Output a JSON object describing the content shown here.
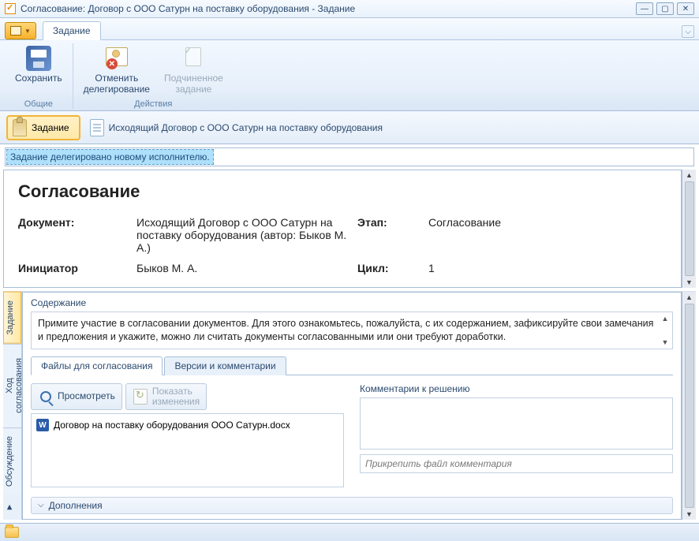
{
  "window": {
    "title": "Согласование: Договор с ООО Сатурн на поставку оборудования - Задание"
  },
  "ribbon": {
    "tab_label": "Задание",
    "groups": {
      "general_label": "Общие",
      "actions_label": "Действия"
    },
    "buttons": {
      "save": "Сохранить",
      "cancel_delegation_l1": "Отменить",
      "cancel_delegation_l2": "делегирование",
      "sub_task_l1": "Подчиненное",
      "sub_task_l2": "задание"
    }
  },
  "subheader": {
    "task_btn": "Задание",
    "doc_link": "Исходящий Договор с ООО Сатурн на поставку оборудования"
  },
  "info_bar": "Задание делегировано новому исполнителю.",
  "form": {
    "heading": "Согласование",
    "labels": {
      "document": "Документ:",
      "stage": "Этап:",
      "initiator_l1": "Инициатор",
      "cycle": "Цикл:"
    },
    "values": {
      "document": "Исходящий Договор с ООО Сатурн на поставку оборудования (автор: Быков М. А.)",
      "stage": "Согласование",
      "initiator": "Быков М. А.",
      "cycle": "1"
    }
  },
  "lower": {
    "side_tabs": {
      "task": "Задание",
      "flow": "Ход согласования",
      "discussion": "Обсуждение"
    },
    "content_label": "Содержание",
    "content_text": "Примите участие в согласовании документов. Для этого ознакомьтесь, пожалуйста, с их содержанием, зафиксируйте свои замечания и предложения и укажите, можно ли считать документы согласованными или они требуют доработки.",
    "inner_tabs": {
      "files": "Файлы для согласования",
      "versions": "Версии и комментарии"
    },
    "toolbar": {
      "preview": "Просмотреть",
      "show_changes_l1": "Показать",
      "show_changes_l2": "изменения"
    },
    "file_item": "Договор на поставку оборудования ООО Сатурн.docx",
    "comments_label": "Комментарии к решению",
    "attach_placeholder": "Прикрепить файл комментария",
    "expand_label": "Дополнения"
  }
}
